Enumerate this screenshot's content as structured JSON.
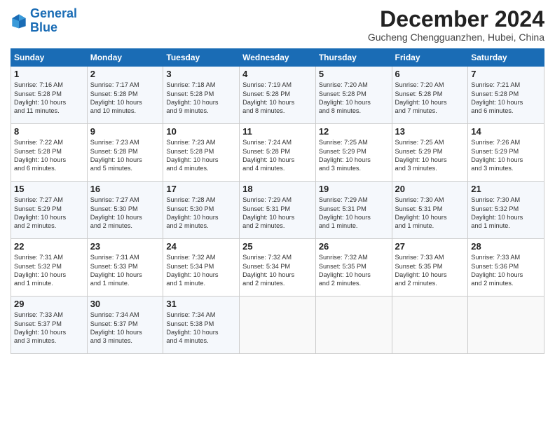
{
  "logo": {
    "line1": "General",
    "line2": "Blue"
  },
  "header": {
    "month": "December 2024",
    "location": "Gucheng Chengguanzhen, Hubei, China"
  },
  "weekdays": [
    "Sunday",
    "Monday",
    "Tuesday",
    "Wednesday",
    "Thursday",
    "Friday",
    "Saturday"
  ],
  "weeks": [
    [
      {
        "day": "1",
        "lines": [
          "Sunrise: 7:16 AM",
          "Sunset: 5:28 PM",
          "Daylight: 10 hours",
          "and 11 minutes."
        ]
      },
      {
        "day": "2",
        "lines": [
          "Sunrise: 7:17 AM",
          "Sunset: 5:28 PM",
          "Daylight: 10 hours",
          "and 10 minutes."
        ]
      },
      {
        "day": "3",
        "lines": [
          "Sunrise: 7:18 AM",
          "Sunset: 5:28 PM",
          "Daylight: 10 hours",
          "and 9 minutes."
        ]
      },
      {
        "day": "4",
        "lines": [
          "Sunrise: 7:19 AM",
          "Sunset: 5:28 PM",
          "Daylight: 10 hours",
          "and 8 minutes."
        ]
      },
      {
        "day": "5",
        "lines": [
          "Sunrise: 7:20 AM",
          "Sunset: 5:28 PM",
          "Daylight: 10 hours",
          "and 8 minutes."
        ]
      },
      {
        "day": "6",
        "lines": [
          "Sunrise: 7:20 AM",
          "Sunset: 5:28 PM",
          "Daylight: 10 hours",
          "and 7 minutes."
        ]
      },
      {
        "day": "7",
        "lines": [
          "Sunrise: 7:21 AM",
          "Sunset: 5:28 PM",
          "Daylight: 10 hours",
          "and 6 minutes."
        ]
      }
    ],
    [
      {
        "day": "8",
        "lines": [
          "Sunrise: 7:22 AM",
          "Sunset: 5:28 PM",
          "Daylight: 10 hours",
          "and 6 minutes."
        ]
      },
      {
        "day": "9",
        "lines": [
          "Sunrise: 7:23 AM",
          "Sunset: 5:28 PM",
          "Daylight: 10 hours",
          "and 5 minutes."
        ]
      },
      {
        "day": "10",
        "lines": [
          "Sunrise: 7:23 AM",
          "Sunset: 5:28 PM",
          "Daylight: 10 hours",
          "and 4 minutes."
        ]
      },
      {
        "day": "11",
        "lines": [
          "Sunrise: 7:24 AM",
          "Sunset: 5:28 PM",
          "Daylight: 10 hours",
          "and 4 minutes."
        ]
      },
      {
        "day": "12",
        "lines": [
          "Sunrise: 7:25 AM",
          "Sunset: 5:29 PM",
          "Daylight: 10 hours",
          "and 3 minutes."
        ]
      },
      {
        "day": "13",
        "lines": [
          "Sunrise: 7:25 AM",
          "Sunset: 5:29 PM",
          "Daylight: 10 hours",
          "and 3 minutes."
        ]
      },
      {
        "day": "14",
        "lines": [
          "Sunrise: 7:26 AM",
          "Sunset: 5:29 PM",
          "Daylight: 10 hours",
          "and 3 minutes."
        ]
      }
    ],
    [
      {
        "day": "15",
        "lines": [
          "Sunrise: 7:27 AM",
          "Sunset: 5:29 PM",
          "Daylight: 10 hours",
          "and 2 minutes."
        ]
      },
      {
        "day": "16",
        "lines": [
          "Sunrise: 7:27 AM",
          "Sunset: 5:30 PM",
          "Daylight: 10 hours",
          "and 2 minutes."
        ]
      },
      {
        "day": "17",
        "lines": [
          "Sunrise: 7:28 AM",
          "Sunset: 5:30 PM",
          "Daylight: 10 hours",
          "and 2 minutes."
        ]
      },
      {
        "day": "18",
        "lines": [
          "Sunrise: 7:29 AM",
          "Sunset: 5:31 PM",
          "Daylight: 10 hours",
          "and 2 minutes."
        ]
      },
      {
        "day": "19",
        "lines": [
          "Sunrise: 7:29 AM",
          "Sunset: 5:31 PM",
          "Daylight: 10 hours",
          "and 1 minute."
        ]
      },
      {
        "day": "20",
        "lines": [
          "Sunrise: 7:30 AM",
          "Sunset: 5:31 PM",
          "Daylight: 10 hours",
          "and 1 minute."
        ]
      },
      {
        "day": "21",
        "lines": [
          "Sunrise: 7:30 AM",
          "Sunset: 5:32 PM",
          "Daylight: 10 hours",
          "and 1 minute."
        ]
      }
    ],
    [
      {
        "day": "22",
        "lines": [
          "Sunrise: 7:31 AM",
          "Sunset: 5:32 PM",
          "Daylight: 10 hours",
          "and 1 minute."
        ]
      },
      {
        "day": "23",
        "lines": [
          "Sunrise: 7:31 AM",
          "Sunset: 5:33 PM",
          "Daylight: 10 hours",
          "and 1 minute."
        ]
      },
      {
        "day": "24",
        "lines": [
          "Sunrise: 7:32 AM",
          "Sunset: 5:34 PM",
          "Daylight: 10 hours",
          "and 1 minute."
        ]
      },
      {
        "day": "25",
        "lines": [
          "Sunrise: 7:32 AM",
          "Sunset: 5:34 PM",
          "Daylight: 10 hours",
          "and 2 minutes."
        ]
      },
      {
        "day": "26",
        "lines": [
          "Sunrise: 7:32 AM",
          "Sunset: 5:35 PM",
          "Daylight: 10 hours",
          "and 2 minutes."
        ]
      },
      {
        "day": "27",
        "lines": [
          "Sunrise: 7:33 AM",
          "Sunset: 5:35 PM",
          "Daylight: 10 hours",
          "and 2 minutes."
        ]
      },
      {
        "day": "28",
        "lines": [
          "Sunrise: 7:33 AM",
          "Sunset: 5:36 PM",
          "Daylight: 10 hours",
          "and 2 minutes."
        ]
      }
    ],
    [
      {
        "day": "29",
        "lines": [
          "Sunrise: 7:33 AM",
          "Sunset: 5:37 PM",
          "Daylight: 10 hours",
          "and 3 minutes."
        ]
      },
      {
        "day": "30",
        "lines": [
          "Sunrise: 7:34 AM",
          "Sunset: 5:37 PM",
          "Daylight: 10 hours",
          "and 3 minutes."
        ]
      },
      {
        "day": "31",
        "lines": [
          "Sunrise: 7:34 AM",
          "Sunset: 5:38 PM",
          "Daylight: 10 hours",
          "and 4 minutes."
        ]
      },
      {
        "day": "",
        "lines": []
      },
      {
        "day": "",
        "lines": []
      },
      {
        "day": "",
        "lines": []
      },
      {
        "day": "",
        "lines": []
      }
    ]
  ]
}
